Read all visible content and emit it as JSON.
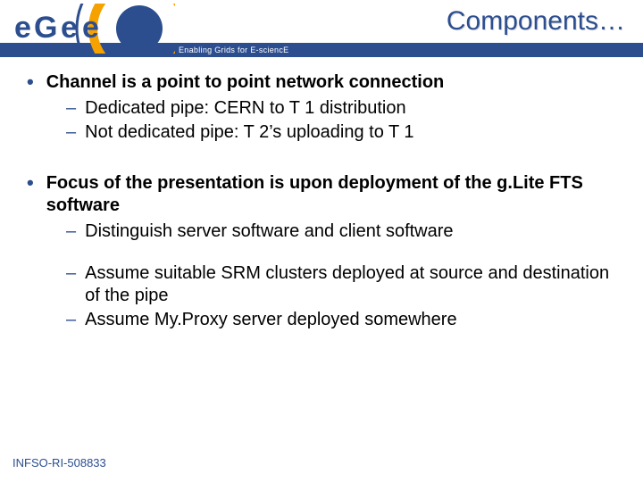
{
  "header": {
    "title": "Components…",
    "subtitle": "Enabling Grids for E-sciencE",
    "logo_name": "egee-logo"
  },
  "bullets": [
    {
      "text": "Channel is a point to point network connection",
      "children": [
        {
          "text": "Dedicated pipe: CERN to T 1 distribution"
        },
        {
          "text": "Not dedicated pipe: T 2’s uploading to T 1"
        }
      ],
      "gap_after": "sm"
    },
    {
      "text": "Focus of the presentation is upon deployment of the g.Lite FTS software",
      "children": [
        {
          "text": "Distinguish server software and client software",
          "gap_after": "md"
        },
        {
          "text": "Assume suitable SRM clusters deployed at source and destination of the pipe"
        },
        {
          "text": "Assume My.Proxy server deployed somewhere"
        }
      ]
    }
  ],
  "footer": {
    "ref": "INFSO-RI-508833"
  },
  "colors": {
    "brand_blue": "#2c4e8f",
    "brand_orange": "#f5a100"
  }
}
